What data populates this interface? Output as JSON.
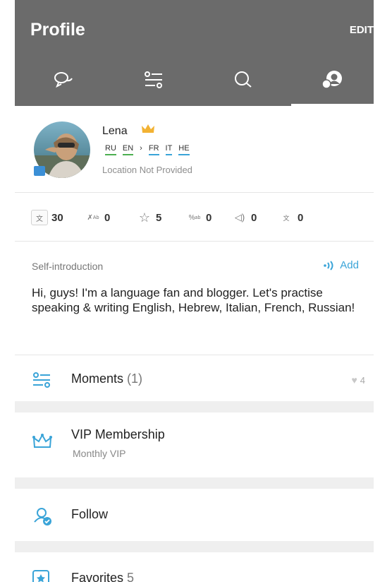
{
  "header": {
    "title": "Profile",
    "edit_label": "EDIT",
    "tabs": [
      {
        "icon": "chat-bubbles-icon"
      },
      {
        "icon": "list-settings-icon"
      },
      {
        "icon": "search-icon"
      },
      {
        "icon": "profile-icon",
        "active": true
      }
    ]
  },
  "profile": {
    "name": "Lena",
    "languages": [
      {
        "code": "RU",
        "bar_color": "#4caf50"
      },
      {
        "code": "EN",
        "bar_color": "#4caf50"
      },
      {
        "code": "FR",
        "bar_color": "#3aa4d8"
      },
      {
        "code": "IT",
        "bar_color": "#3aa4d8"
      },
      {
        "code": "HE",
        "bar_color": "#3aa4d8"
      }
    ],
    "arrow": "›",
    "location": "Location Not Provided"
  },
  "stats": [
    {
      "icon": "stat-translate-icon",
      "value": "30"
    },
    {
      "icon": "stat-correction-icon",
      "value": "0"
    },
    {
      "icon": "stat-star-icon",
      "value": "5"
    },
    {
      "icon": "stat-transliteration-icon",
      "value": "0"
    },
    {
      "icon": "stat-voice-icon",
      "value": "0"
    },
    {
      "icon": "stat-pinyin-icon",
      "value": "0"
    }
  ],
  "intro": {
    "label": "Self-introduction",
    "add_label": "Add",
    "text": "Hi, guys! I'm a language fan and blogger. Let's practise speaking & writing English, Hebrew, Italian, French, Russian!"
  },
  "menu": {
    "moments": {
      "label": "Moments",
      "count": "(1)",
      "likes": "4"
    },
    "vip": {
      "label": "VIP Membership",
      "sub": "Monthly VIP"
    },
    "follow": {
      "label": "Follow"
    },
    "favorites": {
      "label": "Favorites",
      "count": "5"
    }
  },
  "colors": {
    "header_bg": "#6b6b6b",
    "accent": "#3aa4d8",
    "crown": "#f2b233"
  }
}
